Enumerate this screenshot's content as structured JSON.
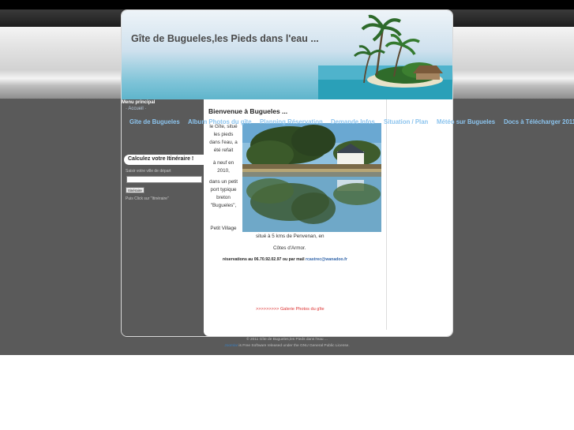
{
  "site": {
    "title": "Gîte de Bugueles,les Pieds dans l'eau ..."
  },
  "left_menu": {
    "title": "Menu principal",
    "accueil": "· Accueil ·"
  },
  "itineraire": {
    "title": "Calculez votre Itinéraire !",
    "input_label": "Saisir votre ville de départ",
    "input_value": "",
    "button_label": "Itinéraire",
    "help": "Puis Click sur \"Itinéraire\""
  },
  "nav": {
    "items": [
      "Gîte de Bugueles",
      "Album Photos du gîte",
      "Planning Réservation",
      "Demande Infos",
      "Situation / Plan",
      "Météo sur Bugueles",
      "Docs à Télécharger 2011"
    ]
  },
  "content": {
    "title": "Bienvenue à Bugueles ...",
    "text_lines": [
      "le Gîte, situé",
      "les pieds",
      "dans l'eau, a",
      "été refait",
      "à neuf en",
      "2010,",
      "dans un petit",
      "port typique",
      "breton",
      "\"Bugueles\",",
      "Petit Village"
    ],
    "situe": "situé à 5 kms de Penvenan, en",
    "cotes": "Côtes d'Armor.",
    "reservations_prefix": "réservations au 06.70.92.02.97 ou par mail",
    "reservations_email": "rcastrec@wanadoo.fr",
    "galerie_link": ">>>>>>>>>  Galerie Photos du gîte"
  },
  "footer": {
    "copyright": "© 2011 Gîte de Bugueles,les Pieds dans l'eau ...",
    "license_link": "Joomla!",
    "license_text": " is Free Software released under the GNU General Public License."
  },
  "colors": {
    "nav_link": "#8cc4ee",
    "email_link": "#3366aa",
    "galerie_link": "#dd3333",
    "panel_gray": "#5a5a5a"
  }
}
